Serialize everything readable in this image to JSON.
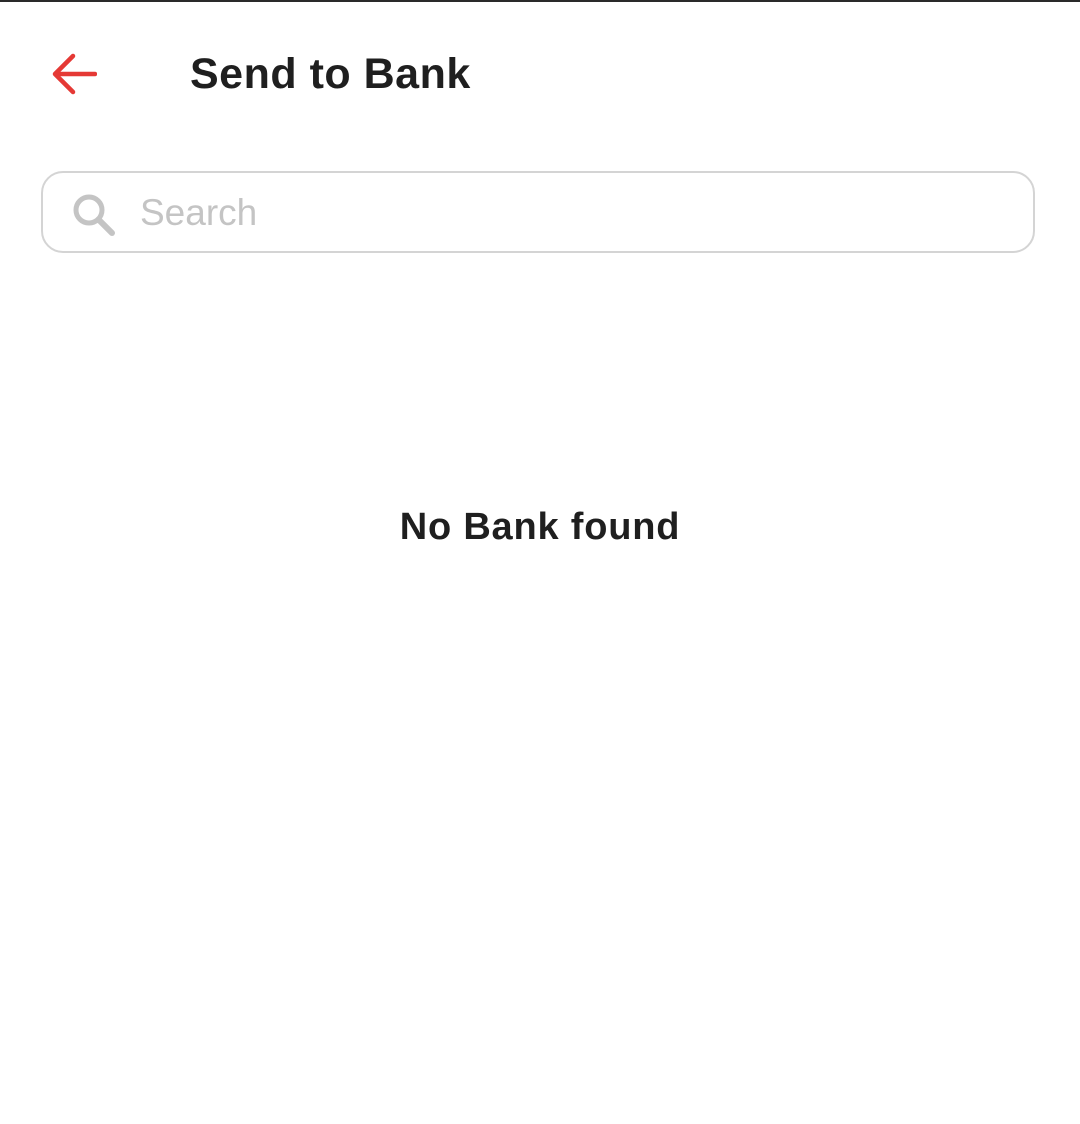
{
  "header": {
    "title": "Send to Bank",
    "back_icon": "arrow-left-icon",
    "accent_color": "#e53935"
  },
  "search": {
    "placeholder": "Search",
    "value": "",
    "icon": "search-icon"
  },
  "empty_state": {
    "message": "No Bank found"
  }
}
